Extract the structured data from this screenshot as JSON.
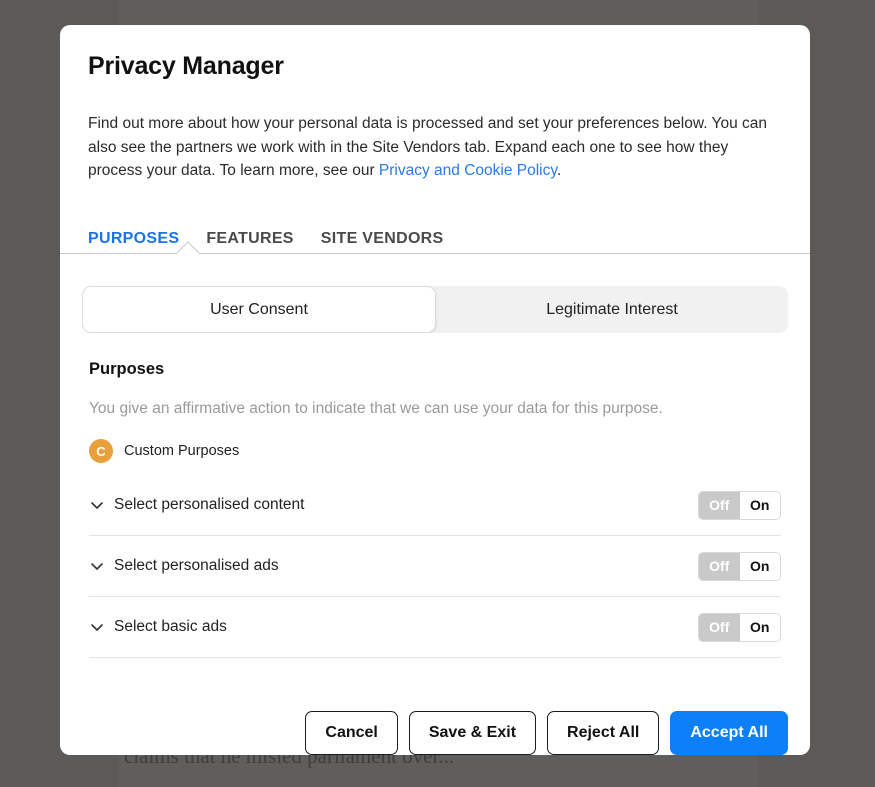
{
  "backdrop": {
    "article_snippet": "claims that he misled parliament over..."
  },
  "modal": {
    "title": "Privacy Manager",
    "intro": {
      "text_before_link": "Find out more about how your personal data is processed and set your preferences below. You can also see the partners we work with in the Site Vendors tab. Expand each one to see how they process your data. To learn more, see our ",
      "link_text": "Privacy and Cookie Policy",
      "text_after_link": "."
    },
    "tabs": [
      {
        "label": "PURPOSES",
        "active": true
      },
      {
        "label": "FEATURES",
        "active": false
      },
      {
        "label": "SITE VENDORS",
        "active": false
      }
    ],
    "consent_basis": {
      "options": [
        {
          "label": "User Consent",
          "selected": true
        },
        {
          "label": "Legitimate Interest",
          "selected": false
        }
      ]
    },
    "section": {
      "title": "Purposes",
      "description": "You give an affirmative action to indicate that we can use your data for this purpose."
    },
    "custom_purposes": {
      "badge_letter": "C",
      "badge_color": "#e8a03c",
      "label": "Custom Purposes"
    },
    "purposes": [
      {
        "label": "Select personalised content",
        "expander_icon": "chevron-down-icon",
        "toggle": {
          "off_label": "Off",
          "on_label": "On",
          "state": "On"
        }
      },
      {
        "label": "Select personalised ads",
        "expander_icon": "chevron-down-icon",
        "toggle": {
          "off_label": "Off",
          "on_label": "On",
          "state": "On"
        }
      },
      {
        "label": "Select basic ads",
        "expander_icon": "chevron-down-icon",
        "toggle": {
          "off_label": "Off",
          "on_label": "On",
          "state": "On"
        }
      }
    ],
    "footer": {
      "cancel_label": "Cancel",
      "save_exit_label": "Save & Exit",
      "reject_all_label": "Reject All",
      "accept_all_label": "Accept All",
      "accept_all_color": "#0d7ff7"
    }
  }
}
